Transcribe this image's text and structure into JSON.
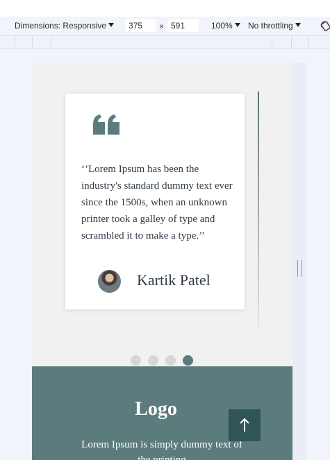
{
  "devtools": {
    "dimensions_label": "Dimensions: Responsive",
    "width_value": "375",
    "height_value": "591",
    "times_symbol": "×",
    "zoom_label": "100%",
    "throttling_label": "No throttling"
  },
  "testimonial": {
    "quote": "‘’Lorem Ipsum has been the industry's standard dummy text ever since the 1500s, when an unknown printer took a galley of type and scrambled it to make a type.’’",
    "author": "Kartik Patel"
  },
  "carousel": {
    "slide_count": 4,
    "active_index": 3
  },
  "footer": {
    "logo": "Logo",
    "text": "Lorem Ipsum is simply dummy text of the printing"
  },
  "colors": {
    "accent": "#5b7b7c",
    "dark_accent": "#2f5556"
  },
  "icons": {
    "quote": "double-quote-icon",
    "back_to_top": "arrow-up-icon",
    "rotate": "rotate-device-icon"
  }
}
